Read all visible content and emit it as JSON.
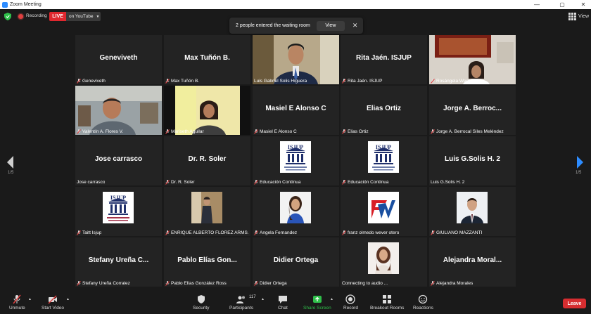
{
  "titlebar": {
    "title": "Zoom Meeting"
  },
  "topbar": {
    "recording": "Recording",
    "live": "LIVE",
    "stream": "on YouTube",
    "view": "View"
  },
  "toast": {
    "message": "2 people entered the waiting room",
    "view": "View"
  },
  "tiles": [
    {
      "big": "Geneviveth",
      "label": "Geneviveth",
      "muted": true
    },
    {
      "big": "Max Tuñón B.",
      "label": "Max Tuñón B.",
      "muted": true
    },
    {
      "big": "",
      "label": "Luis Gabriel Solis Higuera",
      "muted": false,
      "video": "man-suit"
    },
    {
      "big": "Rita Jaén. ISJUP",
      "label": "Rita Jaén. ISJUP",
      "muted": true
    },
    {
      "big": "",
      "label": "Rosángela West Ríos",
      "muted": true,
      "video": "woman-room"
    },
    {
      "big": "",
      "label": "Valentín  A. Flores V.",
      "muted": true,
      "video": "man-office"
    },
    {
      "big": "",
      "label": "Mariseth Aguilar",
      "muted": true,
      "video": "woman-yellow"
    },
    {
      "big": "Masiel E Alonso C",
      "label": "Masiel E Alonso C",
      "muted": true
    },
    {
      "big": "Elias Ortiz",
      "label": "Elias Ortiz",
      "muted": true
    },
    {
      "big": "Jorge A. Berroc...",
      "label": "Jorge A. Berrocal Siles Meléndez",
      "muted": true
    },
    {
      "big": "Jose carrasco",
      "label": "Jose carrasco",
      "muted": false
    },
    {
      "big": "Dr. R. Soler",
      "label": "Dr. R. Soler",
      "muted": true
    },
    {
      "big": "",
      "label": "Educación Contínua",
      "muted": true,
      "video": "isjup-logo"
    },
    {
      "big": "",
      "label": "Educación Contínua",
      "muted": true,
      "video": "isjup-logo"
    },
    {
      "big": "Luis G.Solis H. 2",
      "label": "Luis G.Solis H. 2",
      "muted": false
    },
    {
      "big": "",
      "label": "Taitt Isjup",
      "muted": true,
      "video": "isjup-logo-small"
    },
    {
      "big": "",
      "label": "ENRIQUE ALBERTO FLOREZ ARMS...",
      "muted": true,
      "video": "man-portrait"
    },
    {
      "big": "",
      "label": "Angela Fernandez",
      "muted": true,
      "video": "woman-portrait"
    },
    {
      "big": "",
      "label": "franz olmedo wever otero",
      "muted": true,
      "video": "fw-logo"
    },
    {
      "big": "",
      "label": "GIULIANO MAZZANTI",
      "muted": true,
      "video": "man-suit-portrait"
    },
    {
      "big": "Stefany Ureña C...",
      "label": "Stefany Ureña Corralez",
      "muted": true
    },
    {
      "big": "Pablo Elías Gon...",
      "label": "Pablo Elías González Ross",
      "muted": true
    },
    {
      "big": "Didier Ortega",
      "label": "Didier Ortega",
      "muted": true
    },
    {
      "big": "",
      "label": "Connecting to audio ...",
      "muted": false,
      "video": "woman-portrait-2"
    },
    {
      "big": "Alejandra  Moral...",
      "label": "Alejandra Morales",
      "muted": true
    }
  ],
  "pager": {
    "left": "1/5",
    "right": "1/5"
  },
  "toolbar": {
    "unmute": "Unmute",
    "start_video": "Start Video",
    "security": "Security",
    "participants": "Participants",
    "participant_count": "117",
    "chat": "Chat",
    "share_screen": "Share Screen",
    "record": "Record",
    "breakout": "Breakout Rooms",
    "reactions": "Reactions",
    "leave": "Leave"
  },
  "colors": {
    "live": "#e0272e",
    "active_speaker": "#8fd449",
    "share": "#2fbf4a",
    "leave": "#d62d30"
  }
}
